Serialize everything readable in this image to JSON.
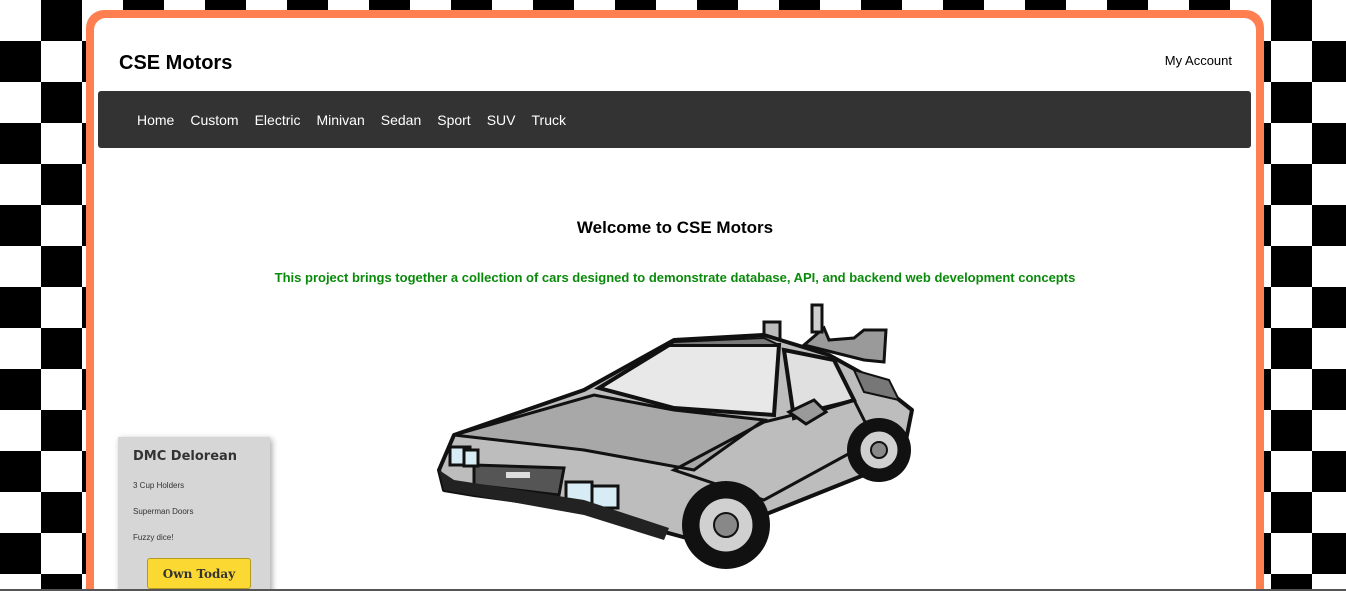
{
  "header": {
    "site_name": "CSE Motors",
    "account_link": "My Account"
  },
  "nav": {
    "items": [
      "Home",
      "Custom",
      "Electric",
      "Minivan",
      "Sedan",
      "Sport",
      "SUV",
      "Truck"
    ]
  },
  "hero": {
    "welcome": "Welcome to CSE Motors",
    "tagline": "This project brings together a collection of cars designed to demonstrate database, API, and backend web development concepts"
  },
  "card": {
    "title": "DMC Delorean",
    "features": [
      "3 Cup Holders",
      "Superman Doors",
      "Fuzzy dice!"
    ],
    "button_label": "Own Today"
  },
  "colors": {
    "border_accent": "#ff7f50",
    "nav_background": "#333333",
    "tagline_text": "#0a8a0a",
    "button_background": "#fcd833",
    "card_background": "#d6d6d6"
  },
  "icons": {
    "car": "delorean-car-image"
  }
}
